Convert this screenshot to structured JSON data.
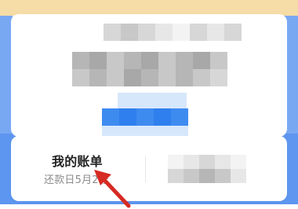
{
  "bill_card": {
    "title": "我的账单",
    "subtitle": "还款日5月2号"
  },
  "colors": {
    "accent_blue": "#2f80ee",
    "background_blue": "#5d96f0",
    "top_strip": "#f6dca6",
    "arrow_red": "#d62a22"
  },
  "icons": {
    "annotation_arrow": "red-arrow-icon"
  }
}
